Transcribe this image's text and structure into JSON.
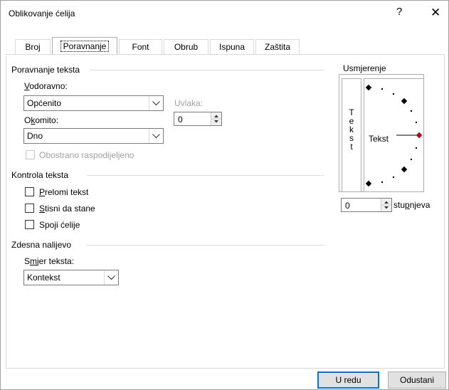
{
  "dialog": {
    "title": "Oblikovanje ćelija",
    "help": "?",
    "close": "✕"
  },
  "tabs": [
    {
      "label": "Broj"
    },
    {
      "label": "Poravnanje"
    },
    {
      "label": "Font"
    },
    {
      "label": "Obrub"
    },
    {
      "label": "Ispuna"
    },
    {
      "label": "Zaštita"
    }
  ],
  "text_alignment": {
    "group_title": "Poravnanje teksta",
    "horizontal": {
      "label_underlined": "V",
      "label_rest": "odoravno:",
      "value": "Općenito"
    },
    "indent": {
      "label": "Uvlaka:",
      "value": "0"
    },
    "vertical": {
      "label_pre": "O",
      "label_underlined": "k",
      "label_rest": "omito:",
      "value": "Dno"
    },
    "justify_distributed": {
      "label": "Obostrano raspodijeljeno",
      "checked": false
    }
  },
  "text_control": {
    "group_title": "Kontrola teksta",
    "wrap": {
      "label_underlined": "P",
      "label_rest": "relomi tekst",
      "checked": false
    },
    "shrink": {
      "label_underlined": "S",
      "label_rest": "tisni da stane",
      "checked": false
    },
    "merge": {
      "label_pre": "Spo",
      "label_underlined": "j",
      "label_rest": "i ćelije",
      "checked": false
    }
  },
  "rtl": {
    "group_title": "Zdesna nalijevo",
    "direction": {
      "label_pre": "S",
      "label_underlined": "m",
      "label_rest": "jer teksta:",
      "value": "Kontekst"
    }
  },
  "orientation": {
    "group_title": "Usmjerenje",
    "vertical_text": [
      "T",
      "e",
      "k",
      "s",
      "t"
    ],
    "arc_text": "Tekst",
    "degrees": {
      "value": "0",
      "label_pre": "stu",
      "label_underlined": "p",
      "label_rest": "njeva"
    },
    "pointer_color": "#c00000"
  },
  "buttons": {
    "ok": "U redu",
    "cancel": "Odustani"
  }
}
